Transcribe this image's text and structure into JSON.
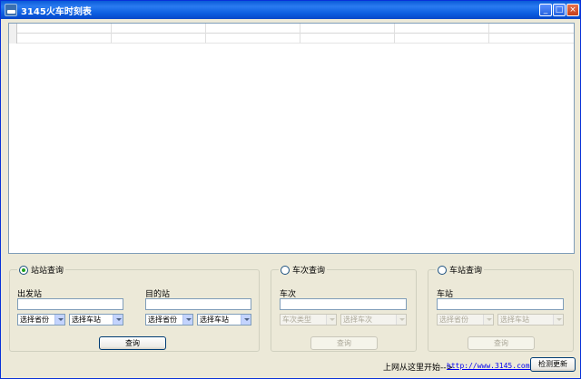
{
  "window": {
    "title": "3145火车时刻表"
  },
  "grid": {
    "columns": [
      "",
      "",
      "",
      "",
      "",
      ""
    ]
  },
  "station_to_station": {
    "radio_label": "站站查询",
    "from_label": "出发站",
    "from_value": "",
    "from_province": "选择省份",
    "from_station": "选择车站",
    "to_label": "目的站",
    "to_value": "",
    "to_province": "选择省份",
    "to_station": "选择车站",
    "query_label": "查询"
  },
  "train_number": {
    "radio_label": "车次查询",
    "field_label": "车次",
    "value": "",
    "type_select": "车次类型",
    "train_select": "选择车次",
    "query_label": "查询"
  },
  "station": {
    "radio_label": "车站查询",
    "field_label": "车站",
    "value": "",
    "province_select": "选择省份",
    "station_select": "选择车站",
    "query_label": "查询"
  },
  "footer": {
    "prompt": "上网从这里开始-->",
    "link": "http://www.3145.com/",
    "update_button": "检测更新"
  }
}
